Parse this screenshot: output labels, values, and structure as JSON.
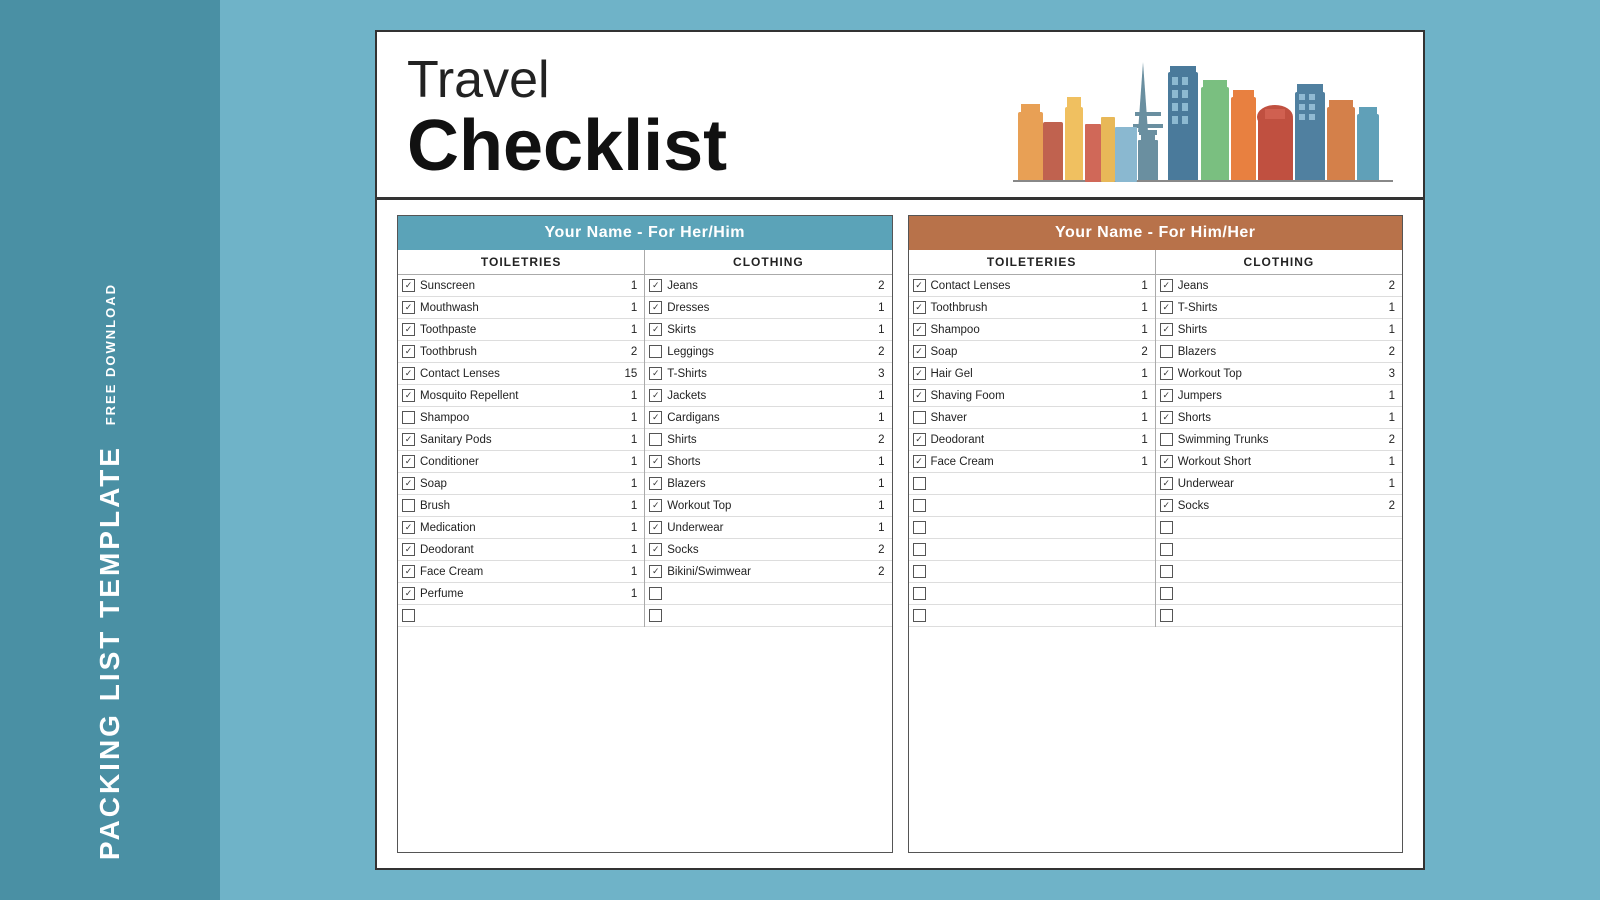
{
  "sidebar": {
    "free_download": "FREE DOWNLOAD",
    "title": "PACKING LIST TEMPLATE"
  },
  "document": {
    "header": {
      "travel": "Travel",
      "checklist": "Checklist"
    },
    "her_section": {
      "title": "Your Name - For Her/Him",
      "toiletries_label": "TOILETRIES",
      "clothing_label": "CLOTHING",
      "toiletries": [
        {
          "name": "Sunscreen",
          "qty": "1",
          "checked": true
        },
        {
          "name": "Mouthwash",
          "qty": "1",
          "checked": true
        },
        {
          "name": "Toothpaste",
          "qty": "1",
          "checked": true
        },
        {
          "name": "Toothbrush",
          "qty": "2",
          "checked": true
        },
        {
          "name": "Contact Lenses",
          "qty": "15",
          "checked": true
        },
        {
          "name": "Mosquito Repellent",
          "qty": "1",
          "checked": true
        },
        {
          "name": "Shampoo",
          "qty": "1",
          "checked": false
        },
        {
          "name": "Sanitary Pods",
          "qty": "1",
          "checked": true
        },
        {
          "name": "Conditioner",
          "qty": "1",
          "checked": true
        },
        {
          "name": "Soap",
          "qty": "1",
          "checked": true
        },
        {
          "name": "Brush",
          "qty": "1",
          "checked": false
        },
        {
          "name": "Medication",
          "qty": "1",
          "checked": true
        },
        {
          "name": "Deodorant",
          "qty": "1",
          "checked": true
        },
        {
          "name": "Face Cream",
          "qty": "1",
          "checked": true
        },
        {
          "name": "Perfume",
          "qty": "1",
          "checked": true
        },
        {
          "name": "",
          "qty": "",
          "checked": false,
          "blank": true
        }
      ],
      "clothing": [
        {
          "name": "Jeans",
          "qty": "2",
          "checked": true
        },
        {
          "name": "Dresses",
          "qty": "1",
          "checked": true
        },
        {
          "name": "Skirts",
          "qty": "1",
          "checked": true
        },
        {
          "name": "Leggings",
          "qty": "2",
          "checked": false
        },
        {
          "name": "T-Shirts",
          "qty": "3",
          "checked": true
        },
        {
          "name": "Jackets",
          "qty": "1",
          "checked": true
        },
        {
          "name": "Cardigans",
          "qty": "1",
          "checked": true
        },
        {
          "name": "Shirts",
          "qty": "2",
          "checked": false
        },
        {
          "name": "Shorts",
          "qty": "1",
          "checked": true
        },
        {
          "name": "Blazers",
          "qty": "1",
          "checked": true
        },
        {
          "name": "Workout Top",
          "qty": "1",
          "checked": true
        },
        {
          "name": "Underwear",
          "qty": "1",
          "checked": true
        },
        {
          "name": "Socks",
          "qty": "2",
          "checked": true
        },
        {
          "name": "Bikini/Swimwear",
          "qty": "2",
          "checked": true
        },
        {
          "name": "",
          "qty": "",
          "checked": false,
          "blank": true
        },
        {
          "name": "",
          "qty": "",
          "checked": false,
          "blank": true
        }
      ]
    },
    "him_section": {
      "title": "Your Name - For Him/Her",
      "toiletries_label": "TOILETERIES",
      "clothing_label": "CLOTHING",
      "toiletries": [
        {
          "name": "Contact Lenses",
          "qty": "1",
          "checked": true
        },
        {
          "name": "Toothbrush",
          "qty": "1",
          "checked": true
        },
        {
          "name": "Shampoo",
          "qty": "1",
          "checked": true
        },
        {
          "name": "Soap",
          "qty": "2",
          "checked": true
        },
        {
          "name": "Hair Gel",
          "qty": "1",
          "checked": true
        },
        {
          "name": "Shaving Foom",
          "qty": "1",
          "checked": true
        },
        {
          "name": "Shaver",
          "qty": "1",
          "checked": false
        },
        {
          "name": "Deodorant",
          "qty": "1",
          "checked": true
        },
        {
          "name": "Face Cream",
          "qty": "1",
          "checked": true
        },
        {
          "name": "",
          "qty": "",
          "checked": false,
          "blank": true
        },
        {
          "name": "",
          "qty": "",
          "checked": false,
          "blank": true
        },
        {
          "name": "",
          "qty": "",
          "checked": false,
          "blank": true
        },
        {
          "name": "",
          "qty": "",
          "checked": false,
          "blank": true
        },
        {
          "name": "",
          "qty": "",
          "checked": false,
          "blank": true
        },
        {
          "name": "",
          "qty": "",
          "checked": false,
          "blank": true
        },
        {
          "name": "",
          "qty": "",
          "checked": false,
          "blank": true
        }
      ],
      "clothing": [
        {
          "name": "Jeans",
          "qty": "2",
          "checked": true
        },
        {
          "name": "T-Shirts",
          "qty": "1",
          "checked": true
        },
        {
          "name": "Shirts",
          "qty": "1",
          "checked": true
        },
        {
          "name": "Blazers",
          "qty": "2",
          "checked": false
        },
        {
          "name": "Workout Top",
          "qty": "3",
          "checked": true
        },
        {
          "name": "Jumpers",
          "qty": "1",
          "checked": true
        },
        {
          "name": "Shorts",
          "qty": "1",
          "checked": true
        },
        {
          "name": "Swimming Trunks",
          "qty": "2",
          "checked": false
        },
        {
          "name": "Workout Short",
          "qty": "1",
          "checked": true
        },
        {
          "name": "Underwear",
          "qty": "1",
          "checked": true
        },
        {
          "name": "Socks",
          "qty": "2",
          "checked": true
        },
        {
          "name": "",
          "qty": "",
          "checked": false,
          "blank": true
        },
        {
          "name": "",
          "qty": "",
          "checked": false,
          "blank": true
        },
        {
          "name": "",
          "qty": "",
          "checked": false,
          "blank": true
        },
        {
          "name": "",
          "qty": "",
          "checked": false,
          "blank": true
        },
        {
          "name": "",
          "qty": "",
          "checked": false,
          "blank": true
        }
      ]
    }
  }
}
